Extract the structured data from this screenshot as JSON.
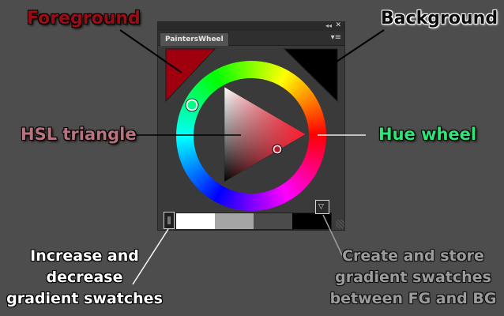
{
  "annotations": {
    "foreground": "Foreground",
    "background": "Background",
    "hsl_triangle": "HSL triangle",
    "hue_wheel": "Hue wheel",
    "increase_decrease": [
      "Increase and",
      "decrease",
      "gradient swatches"
    ],
    "create_store": [
      "Create and store",
      "gradient swatches",
      "between FG and BG"
    ]
  },
  "panel": {
    "tab_label": "PaintersWheel",
    "collapse_icon": "double-chevron-icon",
    "close_icon": "close-icon",
    "menu_icon": "panel-menu-icon"
  },
  "colors": {
    "foreground": "#a0000e",
    "background": "#000000",
    "hue": "#ff1a2e"
  },
  "gradient_swatches": [
    "#ffffff",
    "#a5a5a5",
    "#4b4b4b",
    "#000000"
  ]
}
